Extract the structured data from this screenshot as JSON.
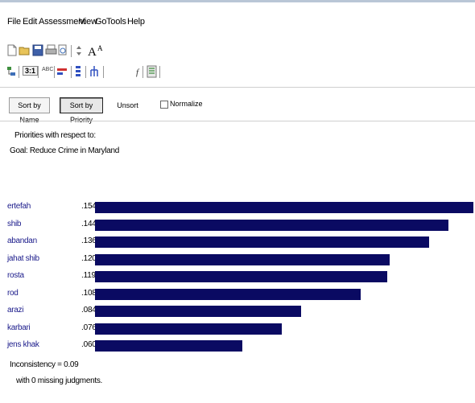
{
  "menu": [
    "File",
    "Edit",
    "Assessment",
    "View",
    "Go",
    "Tools",
    "Help"
  ],
  "toolbar2_labels": [
    "3:1",
    "ABC"
  ],
  "sort_bar": {
    "sort_by_name": "Sort by Name",
    "sort_by_priority": "Sort by Priority",
    "unsort": "Unsort",
    "normalize": "Normalize",
    "normalize_checked": false
  },
  "priorities": {
    "heading": "Priorities with respect to:",
    "goal": "Goal: Reduce Crime in Maryland"
  },
  "chart_data": {
    "type": "bar",
    "orientation": "horizontal",
    "categories": [
      "ertefah",
      "shib",
      "abandan",
      "jahat shib",
      "rosta",
      "rod",
      "arazi",
      "karbari",
      "jens khak"
    ],
    "values": [
      0.154,
      0.144,
      0.136,
      0.12,
      0.119,
      0.108,
      0.084,
      0.076,
      0.06
    ],
    "labels": [
      ".154",
      ".144",
      ".136",
      ".120",
      ".119",
      ".108",
      ".084",
      ".076",
      ".060"
    ],
    "bar_color": "#0a0a62",
    "label_color": "#1a1a8a"
  },
  "footer": {
    "inconsistency": "Inconsistency = 0.09",
    "missing": "with 0  missing judgments."
  }
}
